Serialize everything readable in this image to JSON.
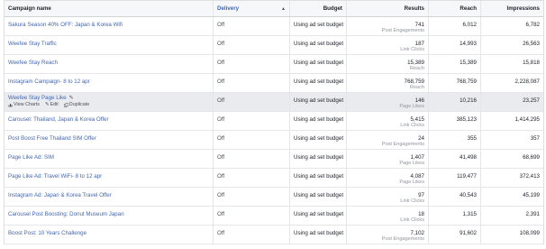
{
  "columns": {
    "name": "Campaign name",
    "delivery": "Delivery",
    "budget": "Budget",
    "results": "Results",
    "reach": "Reach",
    "impressions": "Impressions"
  },
  "icons": {
    "sort": "sort-arrow-icon",
    "edit": "pencil-icon",
    "chart": "bar-chart-icon",
    "duplicate": "duplicate-icon"
  },
  "rows": [
    {
      "name": "Sakura Season 40% OFF: Japan & Korea Wifi",
      "delivery": "Off",
      "budget": "Using ad set budget",
      "results": "741",
      "results_label": "Post Engagements",
      "reach": "6,012",
      "impressions": "6,782"
    },
    {
      "name": "Weefee Stay Traffic",
      "delivery": "Off",
      "budget": "Using ad set budget",
      "results": "187",
      "results_label": "Link Clicks",
      "reach": "14,993",
      "impressions": "26,563"
    },
    {
      "name": "Weefee Stay Reach",
      "delivery": "Off",
      "budget": "Using ad set budget",
      "results": "15,389",
      "results_label": "Reach",
      "reach": "15,389",
      "impressions": "15,818"
    },
    {
      "name": "Instagram Campaign- 8 to 12 apr",
      "delivery": "Off",
      "budget": "Using ad set budget",
      "results": "768,759",
      "results_label": "Reach",
      "reach": "768,759",
      "impressions": "2,228,087"
    },
    {
      "name": "Weefee Stay Page Like",
      "delivery": "Off",
      "budget": "Using ad set budget",
      "results": "146",
      "results_label": "Page Likes",
      "reach": "10,216",
      "impressions": "23,257",
      "actions": [
        "View Charts",
        "Edit",
        "Duplicate"
      ]
    },
    {
      "name": "Carousel: Thailand, Japan & Korea Offer",
      "delivery": "Off",
      "budget": "Using ad set budget",
      "results": "5,415",
      "results_label": "Link Clicks",
      "reach": "385,123",
      "impressions": "1,414,295"
    },
    {
      "name": "Post Boost Free Thailand SIM Offer",
      "delivery": "Off",
      "budget": "Using ad set budget",
      "results": "24",
      "results_label": "Post Engagements",
      "reach": "355",
      "impressions": "357"
    },
    {
      "name": "Page Like Ad: SIM",
      "delivery": "Off",
      "budget": "Using ad set budget",
      "results": "1,407",
      "results_label": "Page Likes",
      "reach": "41,498",
      "impressions": "68,699"
    },
    {
      "name": "Page Like Ad: Travel WiFi- 8 to 12 apr",
      "delivery": "Off",
      "budget": "Using ad set budget",
      "results": "4,087",
      "results_label": "Page Likes",
      "reach": "119,477",
      "impressions": "372,413"
    },
    {
      "name": "Instagram Ad: Japan & Korea Travel Offer",
      "delivery": "Off",
      "budget": "Using ad set budget",
      "results": "97",
      "results_label": "Link Clicks",
      "reach": "40,543",
      "impressions": "45,199"
    },
    {
      "name": "Carousel Post Boosting: Donut Museum Japan",
      "delivery": "Off",
      "budget": "Using ad set budget",
      "results": "18",
      "results_label": "Link Clicks",
      "reach": "1,315",
      "impressions": "2,391"
    },
    {
      "name": "Boost Post: 10 Years Challenge",
      "delivery": "Off",
      "budget": "Using ad set budget",
      "results": "7,102",
      "results_label": "Post Engagements",
      "reach": "91,602",
      "impressions": "108,099"
    }
  ]
}
